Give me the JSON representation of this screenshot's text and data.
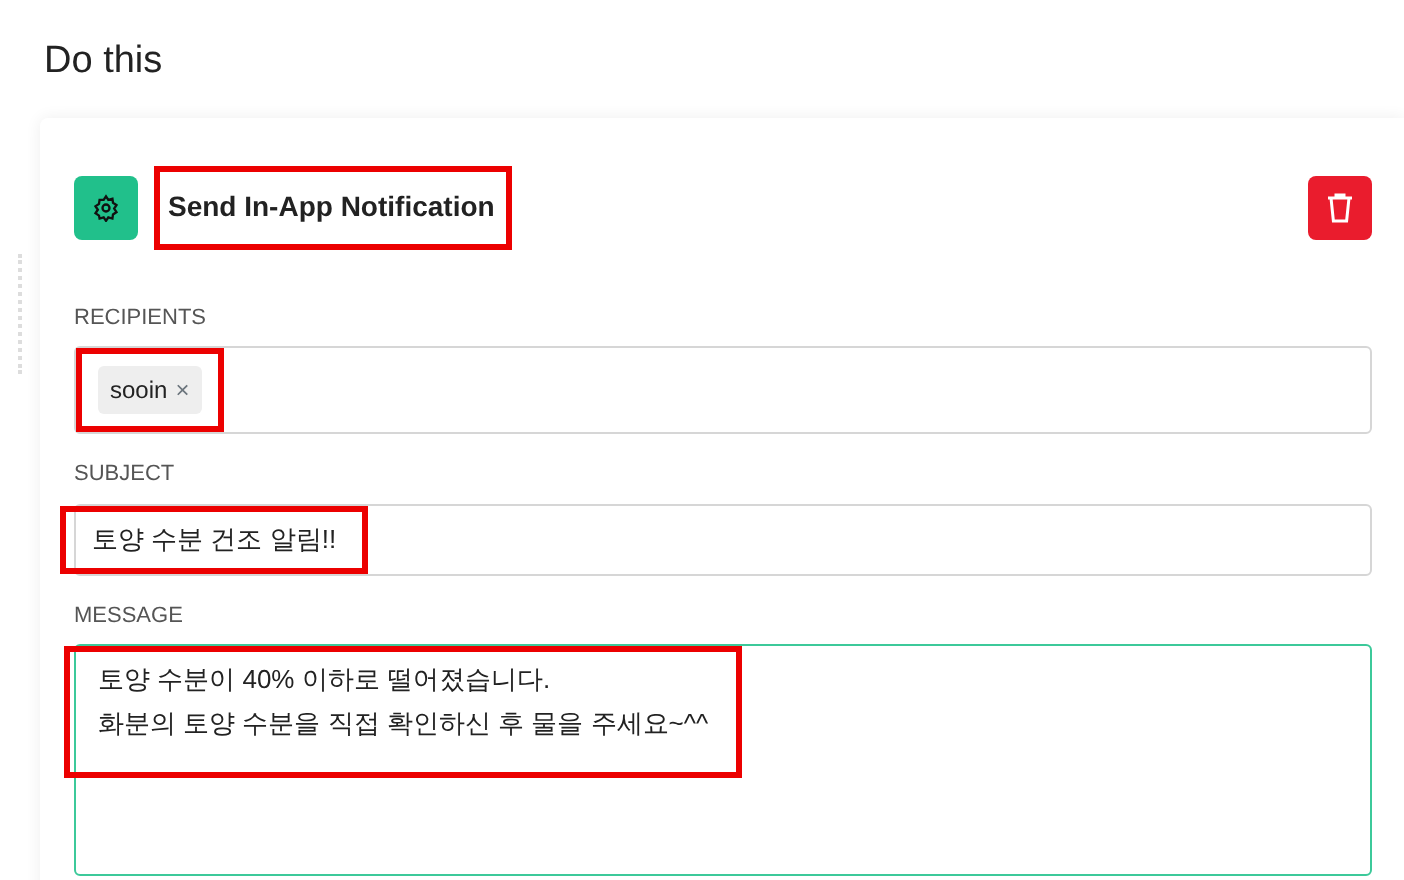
{
  "section_title": "Do this",
  "action": {
    "title": "Send In-App Notification",
    "title_highlighted": true,
    "fields": [
      {
        "kind": "chips",
        "label": "RECIPIENTS",
        "focused": false,
        "highlighted": true,
        "chips": [
          {
            "text": "sooin",
            "remove": "×"
          }
        ]
      },
      {
        "kind": "text",
        "label": "SUBJECT",
        "focused": false,
        "highlighted": true,
        "value": "토양 수분 건조 알림!!"
      },
      {
        "kind": "textarea",
        "label": "MESSAGE",
        "focused": true,
        "highlighted": true,
        "lines": [
          "토양 수분이 40% 이하로 떨어졌습니다.",
          "화분의 토양 수분을 직접 확인하신 후 물을 주세요~^^"
        ]
      }
    ]
  }
}
